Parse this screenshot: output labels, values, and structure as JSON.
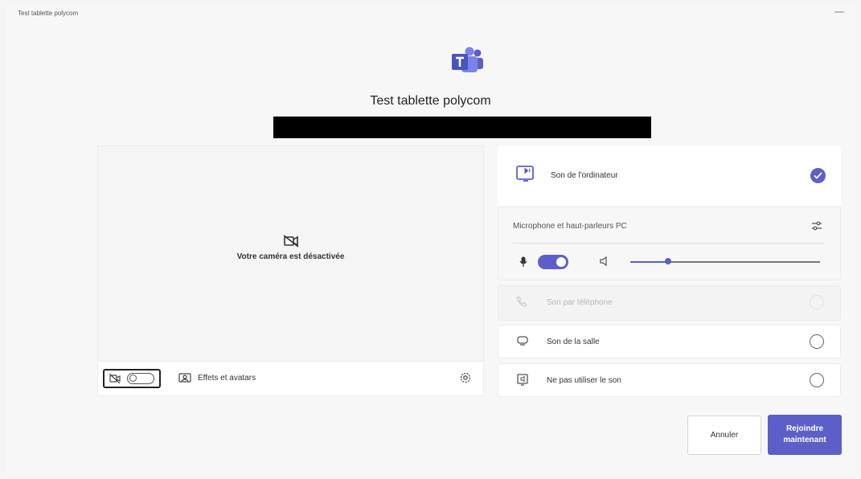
{
  "window": {
    "title": "Test tablette polycom"
  },
  "meeting": {
    "title": "Test tablette polycom"
  },
  "video": {
    "off_text": "Votre caméra est désactivée",
    "effects_label": "Effets et avatars",
    "camera_on": false
  },
  "audio": {
    "computer_label": "Son de l'ordinateur",
    "devices_label": "Microphone et haut-parleurs PC",
    "mic_on": true,
    "volume_level": 0.2,
    "phone_label": "Son par téléphone",
    "room_label": "Son de la salle",
    "none_label": "Ne pas utiliser le son"
  },
  "buttons": {
    "cancel": "Annuler",
    "join": "Rejoindre maintenant"
  },
  "colors": {
    "accent": "#5b5fc7"
  }
}
